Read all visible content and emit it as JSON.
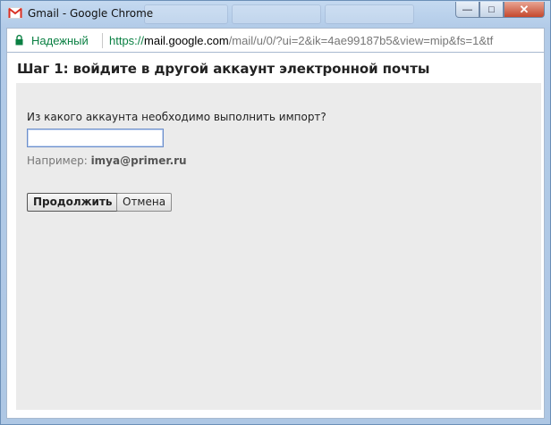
{
  "window": {
    "title": "Gmail - Google Chrome",
    "controls": {
      "minimize": "—",
      "maximize": "□",
      "close": "✕"
    }
  },
  "addressbar": {
    "security_label": "Надежный",
    "url_scheme": "https://",
    "url_host": "mail.google.com",
    "url_path": "/mail/u/0/?ui=2&ik=4ae99187b5&view=mip&fs=1&tf"
  },
  "page": {
    "heading": "Шаг 1: войдите в другой аккаунт электронной почты",
    "question_label": "Из какого аккаунта необходимо выполнить импорт?",
    "account_input": {
      "value": "",
      "placeholder": ""
    },
    "example_prefix": "Например:",
    "example_value": "imya@primer.ru",
    "continue_button": "Продолжить",
    "cancel_button": "Отмена"
  },
  "colors": {
    "secure_green": "#0b8043",
    "close_red": "#c5482d",
    "gmail_red": "#d93025",
    "panel_bg": "#ebebeb"
  },
  "icons": [
    "gmail-icon",
    "lock-icon",
    "minimize-icon",
    "maximize-icon",
    "close-icon"
  ]
}
